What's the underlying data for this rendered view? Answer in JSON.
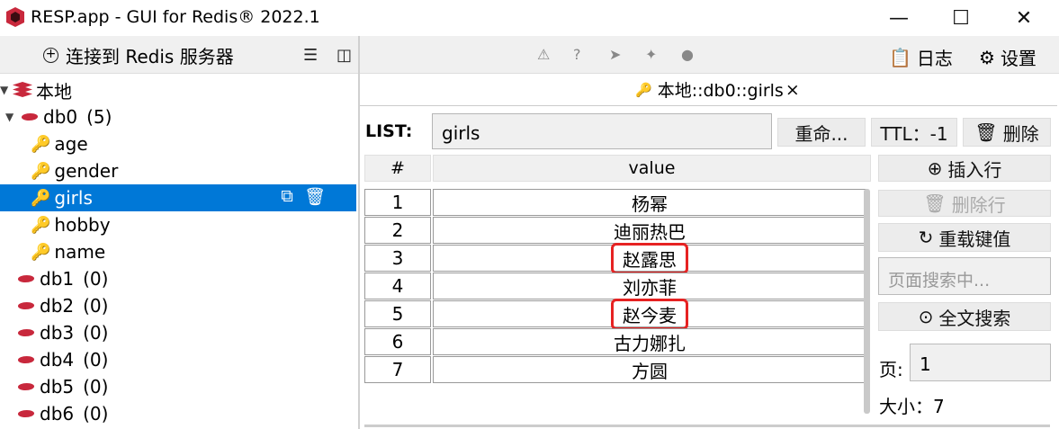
{
  "window": {
    "title": "RESP.app - GUI for Redis® 2022.1",
    "minimize_glyph": "—",
    "maximize_glyph": "☐",
    "close_glyph": "✕"
  },
  "left_toolbar": {
    "connect_label": "连接到 Redis 服务器"
  },
  "tree": {
    "root_label": "本地",
    "db0_label": "db0",
    "db0_count": "(5)",
    "keys": [
      "age",
      "gender",
      "girls",
      "hobby",
      "name"
    ],
    "selected_key": "girls",
    "dbs": [
      {
        "label": "db1",
        "count": "(0)"
      },
      {
        "label": "db2",
        "count": "(0)"
      },
      {
        "label": "db3",
        "count": "(0)"
      },
      {
        "label": "db4",
        "count": "(0)"
      },
      {
        "label": "db5",
        "count": "(0)"
      },
      {
        "label": "db6",
        "count": "(0)"
      }
    ]
  },
  "right_toolbar": {
    "log_label": "日志",
    "settings_label": "设置"
  },
  "tab": {
    "label": "本地::db0::girls",
    "close_glyph": "×"
  },
  "key_view": {
    "type_label": "LIST:",
    "key_name": "girls",
    "rename_label": "重命...",
    "ttl_label": "TTL：-1",
    "delete_label": "删除"
  },
  "table": {
    "col_index": "#",
    "col_value": "value",
    "rows": [
      {
        "index": "1",
        "value": "杨幂"
      },
      {
        "index": "2",
        "value": "迪丽热巴"
      },
      {
        "index": "3",
        "value": "赵露思"
      },
      {
        "index": "4",
        "value": "刘亦菲"
      },
      {
        "index": "5",
        "value": "赵今麦"
      },
      {
        "index": "6",
        "value": "古力娜扎"
      },
      {
        "index": "7",
        "value": "方圆"
      }
    ]
  },
  "side_panel": {
    "insert_row": "插入行",
    "delete_row": "删除行",
    "reload": "重载键值",
    "search_placeholder": "页面搜索中...",
    "full_search": "全文搜索",
    "page_label": "页:",
    "page_value": "1",
    "size_label": "大小：7"
  },
  "colors": {
    "selection": "#0078d7",
    "redis_red": "#c8283c",
    "key_orange": "#e88a00",
    "highlight_box": "#e62222"
  }
}
